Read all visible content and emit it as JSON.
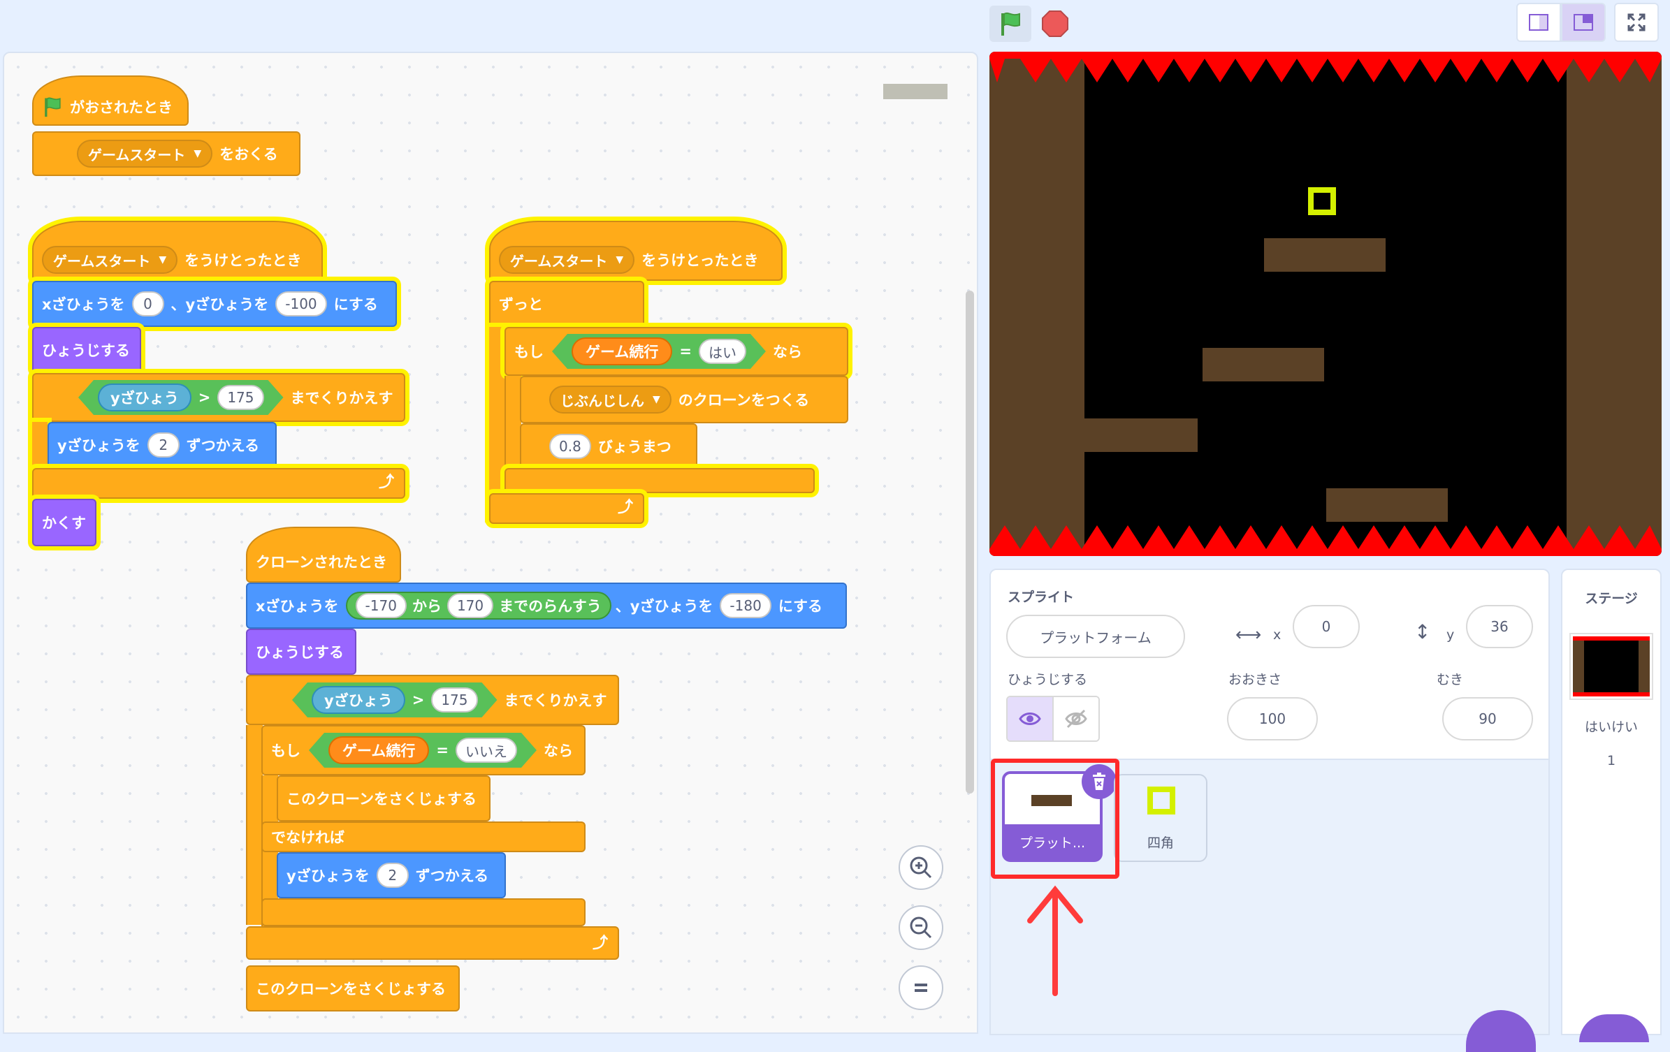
{
  "blocks": {
    "flag_hat": "がおされたとき",
    "broadcast_msg": "ゲームスタート",
    "broadcast_suffix": "をおくる",
    "recv1_msg": "ゲームスタート",
    "recv_suffix": "をうけとったとき",
    "goto_x_label": "xざひょうを",
    "goto_x_val": "0",
    "goto_y_label": "、yざひょうを",
    "goto_y_val": "-100",
    "goto_suffix": "にする",
    "show": "ひょうじする",
    "y_reporter": "yざひょう",
    "gt": ">",
    "repeat_val": "175",
    "repeat_until": "までくりかえす",
    "change_y_label": "yざひょうを",
    "change_y_val": "2",
    "change_suffix": "ずつかえる",
    "hide": "かくす",
    "recv2_msg": "ゲームスタート",
    "forever": "ずっと",
    "if": "もし",
    "game_var": "ゲーム続行",
    "eq": "=",
    "yes": "はい",
    "then": "なら",
    "myself": "じぶんじしん",
    "create_clone": "のクローンをつくる",
    "wait_val": "0.8",
    "wait_suffix": "びょうまつ",
    "clone_hat": "クローンされたとき",
    "rand_x_label": "xざひょうを",
    "rand_from": "-170",
    "from": "から",
    "rand_to": "170",
    "pick_random": "までのらんすう",
    "clone_y_label": "、yざひょうを",
    "clone_y_val": "-180",
    "clone_goto_suffix": "にする",
    "no": "いいえ",
    "delete_clone": "このクローンをさくじょする",
    "else": "でなければ",
    "delete_clone2": "このクローンをさくじょする"
  },
  "sprite_info": {
    "title": "スプライト",
    "name": "プラットフォーム",
    "x_label": "x",
    "x_val": "0",
    "y_label": "y",
    "y_val": "36",
    "show_label": "ひょうじする",
    "size_label": "おおきさ",
    "size_val": "100",
    "dir_label": "むき",
    "dir_val": "90"
  },
  "sprites": [
    {
      "name": "プラット...",
      "selected": true
    },
    {
      "name": "四角",
      "selected": false
    }
  ],
  "stage_panel": {
    "title": "ステージ",
    "backdrop_label": "はいけい",
    "backdrop_count": "1"
  },
  "colors": {
    "event": "#ffab19",
    "motion": "#4c97ff",
    "looks": "#9966ff",
    "operator": "#59c059",
    "variable": "#ff8c1a",
    "highlight": "#fff200",
    "annotation": "#ff3b3b"
  }
}
